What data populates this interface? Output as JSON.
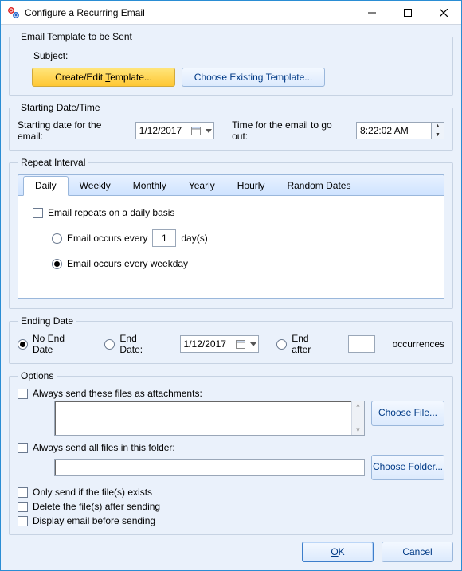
{
  "window": {
    "title": "Configure a Recurring Email"
  },
  "template_group": {
    "legend": "Email Template to be Sent",
    "subject_label": "Subject:",
    "create_edit_btn": "Create/Edit Template...",
    "choose_existing_btn": "Choose Existing Template..."
  },
  "starting_group": {
    "legend": "Starting Date/Time",
    "start_label": "Starting date for the email:",
    "start_date": "1/12/2017",
    "time_label": "Time for the email to go out:",
    "time_value": "8:22:02 AM"
  },
  "repeat_group": {
    "legend": "Repeat Interval",
    "tabs": [
      "Daily",
      "Weekly",
      "Monthly",
      "Yearly",
      "Hourly",
      "Random Dates"
    ],
    "active_tab_index": 0,
    "daily": {
      "repeats_daily_label": "Email repeats on a daily basis",
      "occurs_every_prefix": "Email occurs every",
      "occurs_every_value": "1",
      "occurs_every_suffix": "day(s)",
      "occurs_weekday_label": "Email occurs every weekday",
      "selected": "weekday"
    }
  },
  "ending_group": {
    "legend": "Ending Date",
    "no_end_label": "No End Date",
    "end_date_label": "End Date:",
    "end_date_value": "1/12/2017",
    "end_after_label": "End after",
    "end_after_value": "",
    "occurrences_label": "occurrences",
    "selected": "no_end"
  },
  "options_group": {
    "legend": "Options",
    "attach_label": "Always send these files as attachments:",
    "choose_file_btn": "Choose File...",
    "folder_label": "Always send all files in this folder:",
    "choose_folder_btn": "Choose Folder...",
    "only_if_exists": "Only send if the file(s) exists",
    "delete_after": "Delete the file(s) after sending",
    "display_before": "Display email before sending"
  },
  "footer": {
    "ok": "OK",
    "cancel": "Cancel"
  }
}
